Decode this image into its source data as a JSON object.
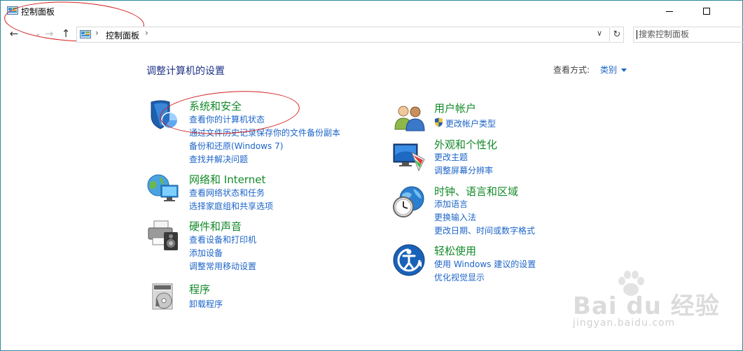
{
  "window": {
    "title": "控制面板"
  },
  "address_bar": {
    "back_glyph": "←",
    "forward_glyph": "→",
    "up_glyph": "↑",
    "separator": "›",
    "crumb": "控制面板",
    "dropdown_glyph": "∨",
    "refresh_glyph": "↻"
  },
  "search": {
    "placeholder": "搜索控制面板"
  },
  "main": {
    "title": "调整计算机的设置",
    "view_by_label": "查看方式:",
    "view_by_value": "类别"
  },
  "categories": [
    {
      "title": "系统和安全",
      "icon": "shield-icon",
      "links": [
        "查看你的计算机状态",
        "通过文件历史记录保存你的文件备份副本",
        "备份和还原(Windows 7)",
        "查找并解决问题"
      ]
    },
    {
      "title": "网络和 Internet",
      "icon": "network-globe-icon",
      "links": [
        "查看网络状态和任务",
        "选择家庭组和共享选项"
      ]
    },
    {
      "title": "硬件和声音",
      "icon": "printer-speaker-icon",
      "links": [
        "查看设备和打印机",
        "添加设备",
        "调整常用移动设置"
      ]
    },
    {
      "title": "程序",
      "icon": "programs-disc-icon",
      "links": [
        "卸载程序"
      ]
    },
    {
      "title": "用户帐户",
      "icon": "users-icon",
      "links": [
        "更改帐户类型"
      ]
    },
    {
      "title": "外观和个性化",
      "icon": "display-palette-icon",
      "links": [
        "更改主题",
        "调整屏幕分辨率"
      ]
    },
    {
      "title": "时钟、语言和区域",
      "icon": "clock-globe-icon",
      "links": [
        "添加语言",
        "更换输入法",
        "更改日期、时间或数字格式"
      ]
    },
    {
      "title": "轻松使用",
      "icon": "ease-of-access-icon",
      "links": [
        "使用 Windows 建议的设置",
        "优化视觉显示"
      ]
    }
  ],
  "watermark": {
    "logo": "Bai du 经验",
    "url": "jingyan.baidu.com"
  },
  "colors": {
    "category_title": "#128a28",
    "link": "#1c64c8",
    "page_title": "#1e3287",
    "annotation_ellipse": "#d21f1f"
  }
}
